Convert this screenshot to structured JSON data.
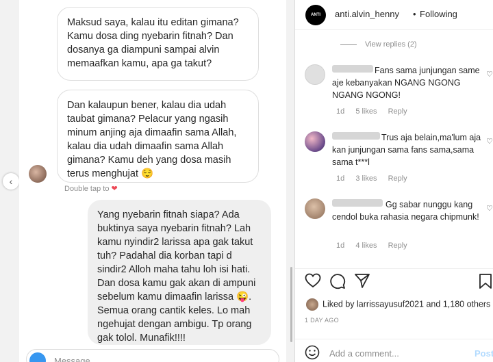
{
  "chat": {
    "messages_in": [
      "Maksud saya, kalau itu editan gimana? Kamu dosa ding nyebarin fitnah? Dan dosanya ga diampuni sampai alvin memaafkan kamu, apa ga takut?",
      "Dan kalaupun bener, kalau dia udah taubat gimana? Pelacur yang ngasih minum anjing aja dimaafin sama Allah, kalau dia udah dimaafin sama Allah gimana? Kamu deh yang dosa masih terus menghujat 😌"
    ],
    "double_tap": "Double tap to",
    "heart": "❤",
    "message_out": "Yang nyebarin fitnah siapa? Ada buktinya saya nyebarin fitnah? Lah kamu nyindir2 larissa apa gak takut tuh? Padahal dia korban tapi d sindir2 Alloh maha tahu loh isi hati. Dan dosa kamu gak akan di ampuni sebelum kamu dimaafin larissa 😜. Semua orang cantik keles. Lo mah ngehujat dengan ambigu. Tp orang gak tolol. Munafik!!!!",
    "message_placeholder": "Message...",
    "nav_arrow": "‹"
  },
  "post": {
    "header": {
      "avatar_text": "ANTI",
      "username": "anti.alvin_henny",
      "dot": "•",
      "following": "Following"
    },
    "view_replies": "View replies (2)",
    "comments": [
      {
        "text": "Fans sama junjungan same aje kebanyakan NGANG NGONG NGANG NGONG!",
        "age": "1d",
        "likes": "5 likes",
        "reply": "Reply"
      },
      {
        "text": "Trus aja belain,ma'lum aja kan junjungan sama fans sama,sama sama t***l",
        "age": "1d",
        "likes": "3 likes",
        "reply": "Reply"
      },
      {
        "text": "Gg sabar nunggu kang cendol buka rahasia negara chipmunk!",
        "age": "1d",
        "likes": "4 likes",
        "reply": "Reply"
      }
    ],
    "liked_by_prefix": "Liked by ",
    "liked_by_user": "larrissayusuf2021",
    "liked_by_and": " and ",
    "liked_by_others": "1,180 others",
    "time_ago": "1 DAY AGO",
    "add_comment_placeholder": "Add a comment...",
    "post_button": "Post",
    "colors": {
      "link_blue": "#b3dbff",
      "heart_red": "#ed4956"
    }
  }
}
